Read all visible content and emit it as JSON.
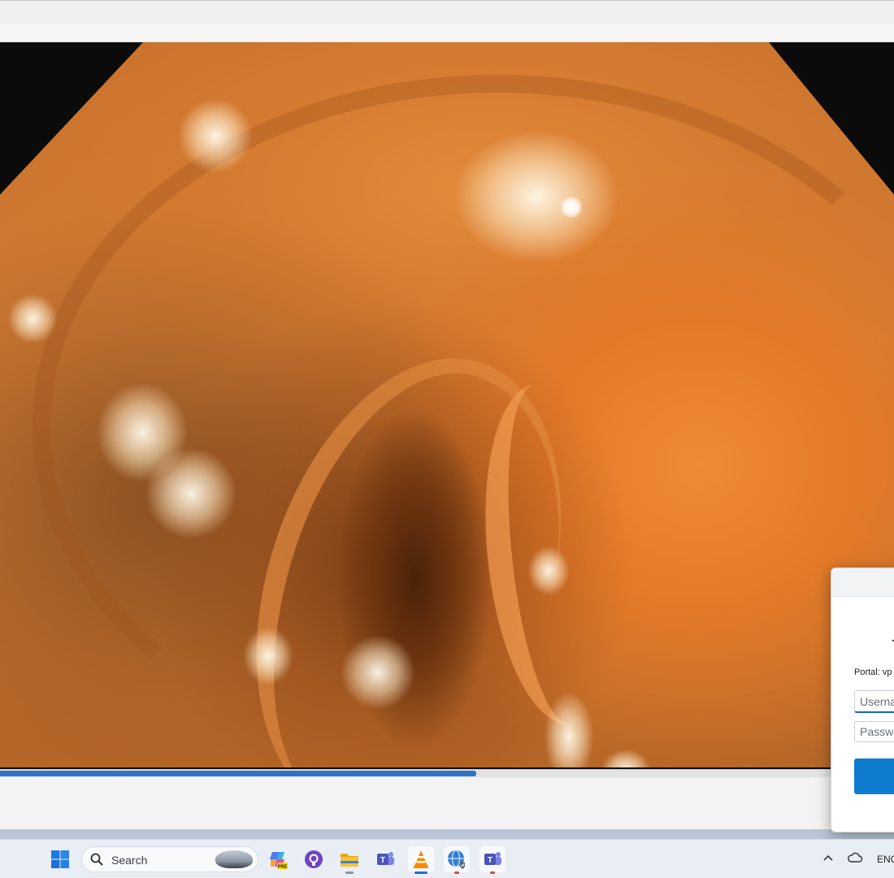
{
  "window": {},
  "player": {
    "progress_fraction": 0.533
  },
  "vpn_dialog": {
    "portal_text": "Portal: vp",
    "username_placeholder": "Userna",
    "password_placeholder": "Passwo"
  },
  "taskbar": {
    "search_text": "Search",
    "language_text": "ENG",
    "icons": [
      "windows-start-icon",
      "search-icon",
      "copilot-pre-icon",
      "github-icon",
      "file-explorer-icon",
      "teams-icon",
      "vlc-icon",
      "globe-vpn-icon",
      "teams-work-icon"
    ],
    "tray_icons": [
      "chevron-up-icon",
      "onedrive-cloud-icon"
    ]
  },
  "colors": {
    "accent": "#1f6fd0",
    "progress": "#2d72c9",
    "signin_button": "#0f7ccf"
  }
}
